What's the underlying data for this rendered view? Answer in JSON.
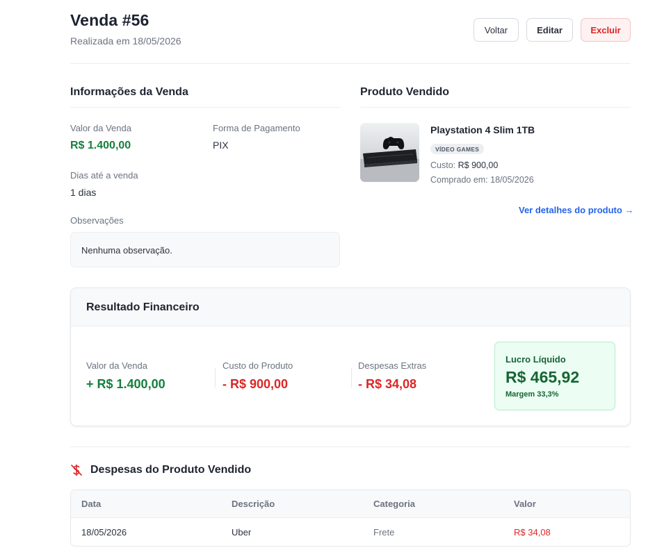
{
  "header": {
    "title": "Venda #56",
    "subtitle": "Realizada em 18/05/2026",
    "back_label": "Voltar",
    "edit_label": "Editar",
    "delete_label": "Excluir"
  },
  "sale_info": {
    "title": "Informações da Venda",
    "sale_value_label": "Valor da Venda",
    "sale_value": "R$ 1.400,00",
    "payment_label": "Forma de Pagamento",
    "payment_value": "PIX",
    "days_label": "Dias até a venda",
    "days_value": "1 dias",
    "notes_label": "Observações",
    "notes_value": "Nenhuma observação."
  },
  "product": {
    "title": "Produto Vendido",
    "name": "Playstation 4 Slim 1TB",
    "category_badge": "VÍDEO GAMES",
    "cost_label": "Custo:",
    "cost_value": "R$ 900,00",
    "purchased": "Comprado em: 18/05/2026",
    "details_link": "Ver detalhes do produto →",
    "image_icon": "playstation-console-photo"
  },
  "financial": {
    "title": "Resultado Financeiro",
    "sale_label": "Valor da Venda",
    "sale_value": "+ R$ 1.400,00",
    "cost_label": "Custo do Produto",
    "cost_value": "- R$ 900,00",
    "extra_label": "Despesas Extras",
    "extra_value": "- R$ 34,08",
    "profit_label": "Lucro Líquido",
    "profit_value": "R$ 465,92",
    "margin": "Margem 33,3%"
  },
  "expenses": {
    "title": "Despesas do Produto Vendido",
    "icon": "dollar-off-icon",
    "columns": [
      "Data",
      "Descrição",
      "Categoria",
      "Valor"
    ],
    "rows": [
      {
        "date": "18/05/2026",
        "description": "Uber",
        "category": "Frete",
        "value": "R$ 34,08"
      }
    ]
  },
  "colors": {
    "green": "#15803d",
    "red": "#dc2626",
    "link": "#2563eb"
  }
}
